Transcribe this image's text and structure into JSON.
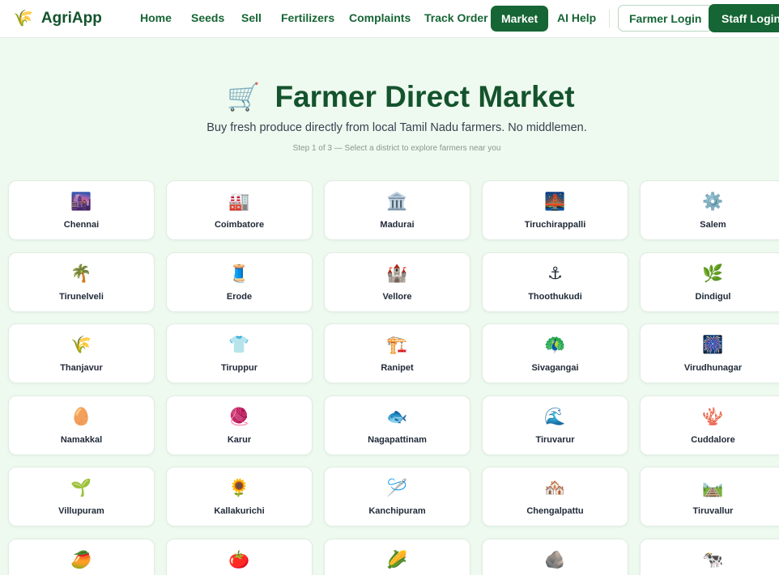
{
  "brand": {
    "name": "AgriApp",
    "icon": "🌾"
  },
  "nav": {
    "links": [
      "Home",
      "Seeds",
      "Sell",
      "Fertilizers",
      "Complaints",
      "Track Order",
      "Market",
      "AI Help"
    ],
    "active": "Market",
    "farmer_login": "Farmer Login",
    "staff_login": "Staff Login"
  },
  "hero": {
    "icon": "🛒",
    "title": "Farmer Direct Market",
    "subtitle": "Buy fresh produce directly from local Tamil Nadu farmers. No middlemen.",
    "step": "Step 1 of 3 — Select a district to explore farmers near you"
  },
  "districts": [
    {
      "name": "Chennai",
      "icon": "🌆"
    },
    {
      "name": "Coimbatore",
      "icon": "🏭"
    },
    {
      "name": "Madurai",
      "icon": "🏛️"
    },
    {
      "name": "Tiruchirappalli",
      "icon": "🌉"
    },
    {
      "name": "Salem",
      "icon": "⚙️"
    },
    {
      "name": "Tirunelveli",
      "icon": "🌴"
    },
    {
      "name": "Erode",
      "icon": "🧵"
    },
    {
      "name": "Vellore",
      "icon": "🏰"
    },
    {
      "name": "Thoothukudi",
      "icon": "⚓"
    },
    {
      "name": "Dindigul",
      "icon": "🌿"
    },
    {
      "name": "Thanjavur",
      "icon": "🌾"
    },
    {
      "name": "Tiruppur",
      "icon": "👕"
    },
    {
      "name": "Ranipet",
      "icon": "🏗️"
    },
    {
      "name": "Sivagangai",
      "icon": "🦚"
    },
    {
      "name": "Virudhunagar",
      "icon": "🎆"
    },
    {
      "name": "Namakkal",
      "icon": "🥚"
    },
    {
      "name": "Karur",
      "icon": "🧶"
    },
    {
      "name": "Nagapattinam",
      "icon": "🐟"
    },
    {
      "name": "Tiruvarur",
      "icon": "🌊"
    },
    {
      "name": "Cuddalore",
      "icon": "🪸"
    },
    {
      "name": "Villupuram",
      "icon": "🌱"
    },
    {
      "name": "Kallakurichi",
      "icon": "🌻"
    },
    {
      "name": "Kanchipuram",
      "icon": "🪡"
    },
    {
      "name": "Chengalpattu",
      "icon": "🏘️"
    },
    {
      "name": "Tiruvallur",
      "icon": "🛤️"
    },
    {
      "name": "",
      "icon": "🥭"
    },
    {
      "name": "",
      "icon": "🍅"
    },
    {
      "name": "",
      "icon": "🌽"
    },
    {
      "name": "",
      "icon": "🪨"
    },
    {
      "name": "",
      "icon": "🐄"
    }
  ]
}
